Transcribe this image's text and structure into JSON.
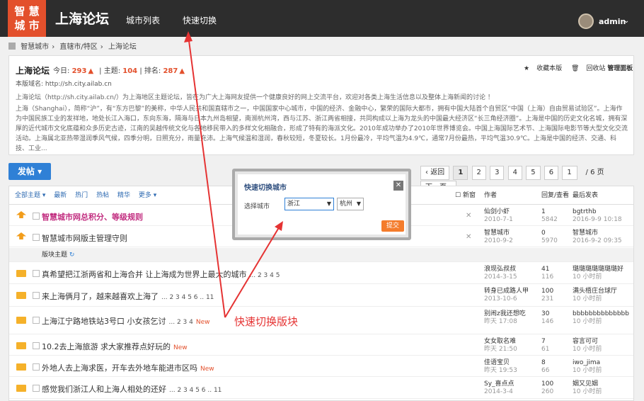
{
  "header": {
    "logo_text": "智慧城市",
    "site_name": "上海论坛",
    "nav": [
      "城市列表",
      "快速切换"
    ],
    "user": "admin"
  },
  "breadcrumb": [
    "智慧城市",
    "直辖市/特区",
    "上海论坛"
  ],
  "forum": {
    "title": "上海论坛",
    "today_label": "今日:",
    "today": "293",
    "topics_label": "主题:",
    "topics": "104",
    "rank_label": "排名:",
    "rank": "287",
    "domain": "本版域名: http://sh.city.ailab.cn",
    "intro": "上海论坛（http://sh.city.ailab.cn/）为上海地区主题论坛，皆在为广大上海网友提供一个健康良好的网上交流平台，欢迎对各类上海生活信息以及整体上海新闻的讨论 ！",
    "desc": "上海（Shanghai），简称“沪”，有“东方巴黎”的美称，中华人民共和国直辖市之一，中国国家中心城市，中国的经济、金融中心，繁荣的国际大都市，拥有中国大陆首个自贸区“中国（上海）自由贸易试验区”。上海作为中国民族工业的发祥地，地处长江入海口，东向东海，隔海与日本九州岛相望，南濒杭州湾，西与江苏、浙江两省相接，共同构成以上海为龙头的中国最大经济区“长三角经济圈”。上海是中国的历史文化名城，拥有深厚的近代城市文化底蕴和众多历史古迹，江南的吴越传统文化与各地移民带入的多样文化相融合，形成了特有的海派文化。2010年成功举办了2010年世界博览会。中国上海国际艺术节、上海国际电影节等大型文化交流活动。上海属北亚热带湿润季风气候，四季分明，日照充分，雨量充沛。上海气候温和湿润，春秋较短，冬夏较长。1月份最冷，平均气温为4.9℃，通常7月份最热，平均气温30.9℃。上海是中国的经济、交通、科技、工业...",
    "links": [
      "收藏本版",
      "回收站",
      "管理面板"
    ]
  },
  "toolbar": {
    "post": "发帖",
    "pager": [
      "返回",
      "1",
      "2",
      "3",
      "4",
      "5",
      "6",
      "1",
      "/ 6 页",
      "下一页"
    ]
  },
  "table_head": {
    "tabs": [
      "全部主题",
      "最新",
      "热门",
      "热帖",
      "精华",
      "更多"
    ],
    "new": "新窗",
    "author": "作者",
    "reply": "回复/查看",
    "last": "最后发表"
  },
  "sticky": [
    {
      "title": "智慧城市网总积分、等级规则",
      "author": "仙剑小虾",
      "date": "2010-7-1",
      "replies": "1",
      "views": "5842",
      "last_user": "bgtrthb",
      "last_time": "2016-9-9 10:18"
    },
    {
      "title": "智慧城市网版主管理守则",
      "author": "智慧城市",
      "date": "2010-9-2",
      "replies": "0",
      "views": "5970",
      "last_user": "智慧城市",
      "last_time": "2016-9-2 09:35"
    }
  ],
  "section_label": "版块主题",
  "threads": [
    {
      "title": "真希望把江浙两省和上海合并 让上海成为世界上最大的城市",
      "pages": "... 2 3 4 5",
      "author": "浪现弘叔叔",
      "date": "2014-3-15",
      "replies": "41",
      "views": "116",
      "last_user": "璐璐璐璐璐璐璐好",
      "last_time": "10 小时前"
    },
    {
      "title": "来上海俩月了，越来越喜欢上海了",
      "pages": "... 2 3 4 5 6 .. 11",
      "author": "转身已成路人甲",
      "date": "2013-10-6",
      "replies": "100",
      "views": "231",
      "last_user": "满头梧庄台球厅",
      "last_time": "10 小时前"
    },
    {
      "title": "上海江宁路地铁站3号口 小女孩乞讨",
      "pages": "... 2 3 4",
      "new": "New",
      "author": "别闹z我还想吃",
      "date": "昨天 17:08",
      "replies": "30",
      "views": "146",
      "last_user": "bbbbbbbbbbbbbb",
      "last_time": "10 小时前"
    },
    {
      "title": "10.2去上海旅游 求大家推荐点好玩的",
      "new": "New",
      "author": "女女取名难",
      "date": "昨天 21:50",
      "replies": "7",
      "views": "61",
      "last_user": "容言可可",
      "last_time": "10 小时前"
    },
    {
      "title": "外地人去上海求医，开车去外地车能进市区吗",
      "new": "New",
      "author": "佳语宝贝",
      "date": "昨天 19:53",
      "replies": "8",
      "views": "66",
      "last_user": "iwo_jima",
      "last_time": "10 小时前"
    },
    {
      "title": "感觉我们浙江人和上海人相处的还好",
      "pages": "... 2 3 4 5 6 .. 11",
      "author": "Sy_喜点点",
      "date": "2014-3-4",
      "replies": "100",
      "views": "260",
      "last_user": "姻又见姻",
      "last_time": "10 小时前"
    }
  ],
  "modal": {
    "title": "快速切换城市",
    "label": "选择城市",
    "province": "浙江",
    "city": "杭州",
    "submit": "提交"
  },
  "annotation": "快速切换版块",
  "colors": {
    "accent": "#e3502c",
    "annotation": "#e53333",
    "primary": "#2f80d6"
  }
}
